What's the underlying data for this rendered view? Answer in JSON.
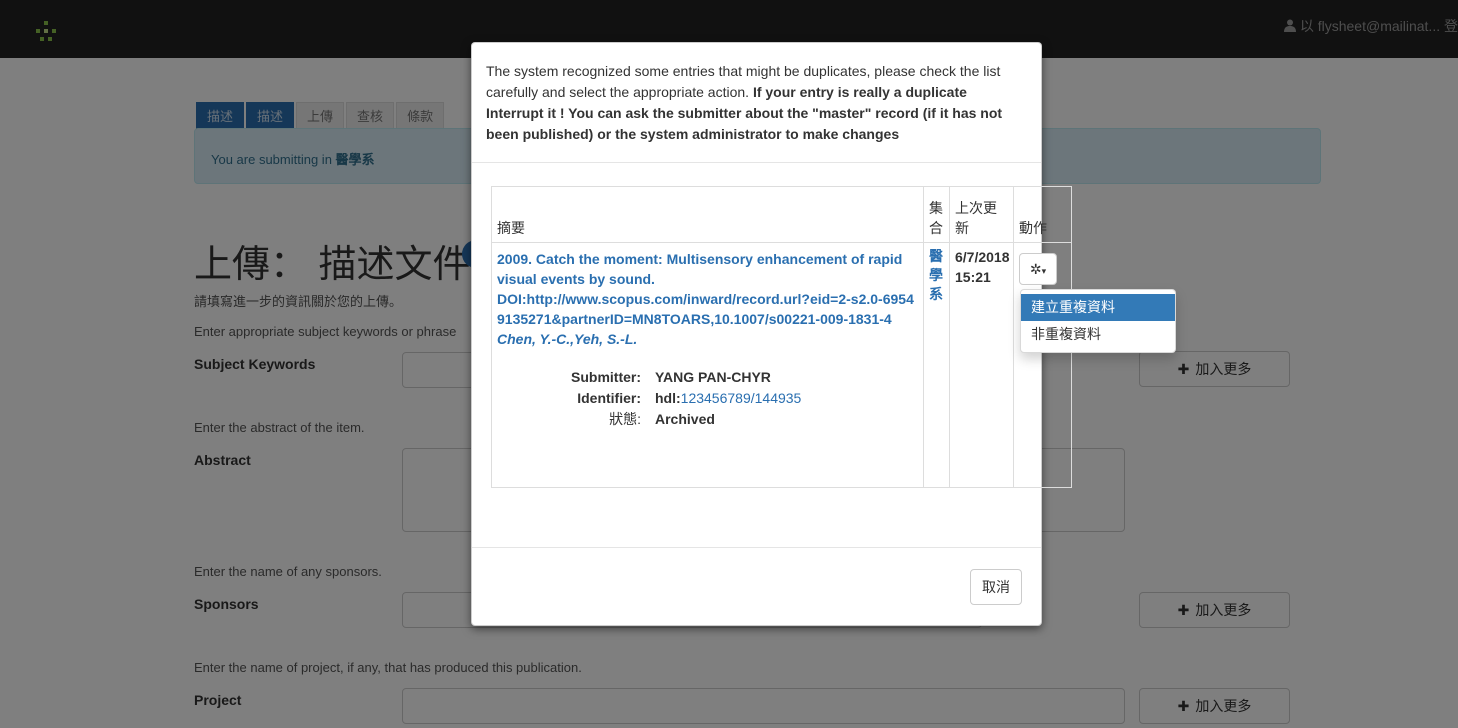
{
  "navbar": {
    "user": "以 flysheet@mailinat... 登"
  },
  "tabs": [
    "描述",
    "描述",
    "上傳",
    "查核",
    "條款"
  ],
  "alert": {
    "prefix": "You are submitting in ",
    "collection": "醫學系"
  },
  "page": {
    "title": "上傳： 描述文件",
    "intro": "請填寫進一步的資訊關於您的上傳。",
    "subject_help": "Enter appropriate subject keywords or phrase",
    "subject_label": "Subject Keywords",
    "abstract_help": "Enter the abstract of the item.",
    "abstract_label": "Abstract",
    "sponsors_help": "Enter the name of any sponsors.",
    "sponsors_label": "Sponsors",
    "project_help": "Enter the name of project, if any, that has produced this publication.",
    "project_label": "Project",
    "add_more": "加入更多"
  },
  "modal": {
    "message_plain": "The system recognized some entries that might be duplicates, please check the list carefully and select the appropriate action. ",
    "message_bold": "If your entry is really a duplicate Interrupt it ! You can ask the submitter about the \"master\" record (if it has not been published) or the system administrator to make changes",
    "columns": {
      "summary": "摘要",
      "collection": "集合",
      "last_update": "上次更新",
      "action": "動作"
    },
    "entry": {
      "title": "2009. Catch the moment: Multisensory enhancement of rapid visual events by sound.",
      "doi": "DOI:http://www.scopus.com/inward/record.url?eid=2-s2.0-69549135271&partnerID=MN8TOARS,10.1007/s00221-009-1831-4",
      "authors": "Chen, Y.-C.,Yeh, S.-L.",
      "submitter_key": "Submitter:",
      "submitter": "YANG PAN-CHYR",
      "identifier_key": "Identifier:",
      "identifier_prefix": "hdl:",
      "identifier": "123456789/144935",
      "status_key": "狀態:",
      "status": "Archived",
      "collection": "醫學系",
      "last_update": "6/7/2018 15:21"
    },
    "dropdown": [
      "建立重複資料",
      "非重複資料"
    ],
    "cancel": "取消"
  }
}
